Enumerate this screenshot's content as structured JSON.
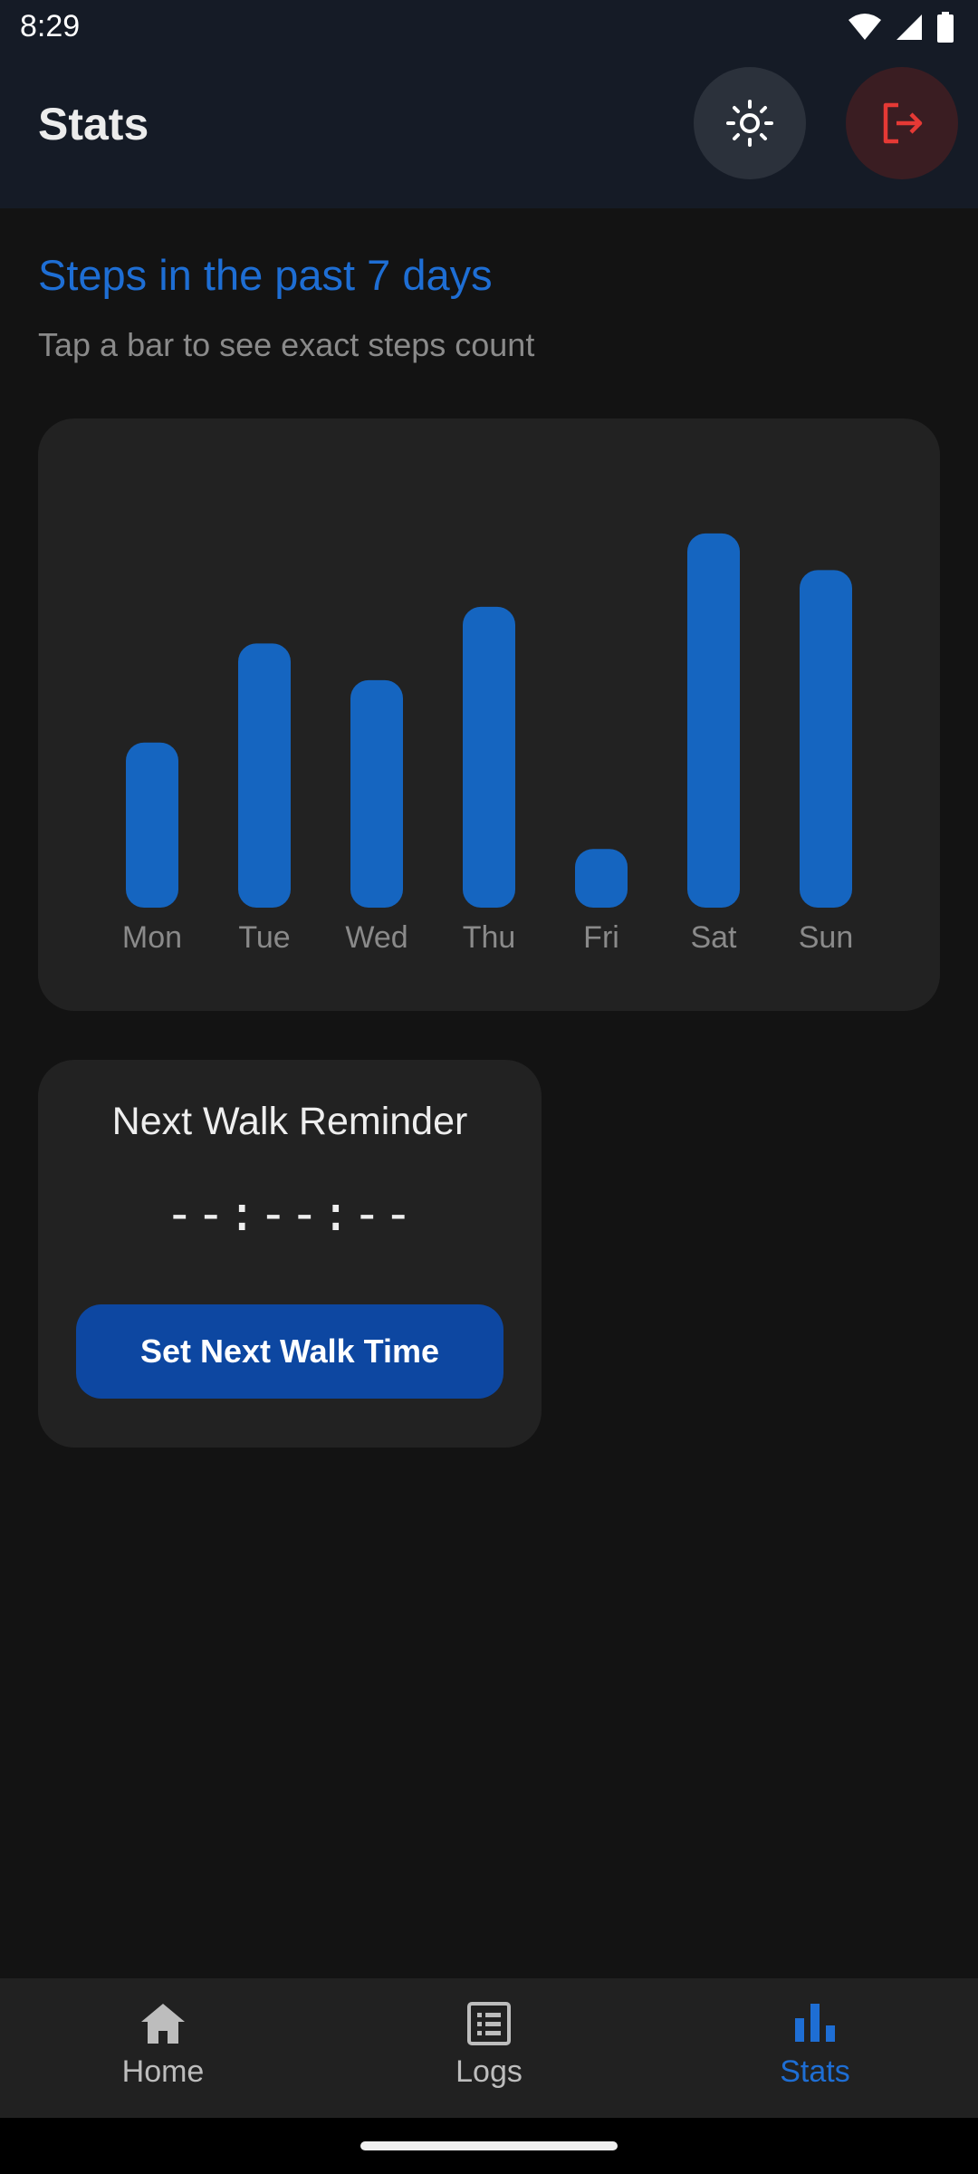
{
  "status_bar": {
    "time": "8:29"
  },
  "header": {
    "title": "Stats",
    "theme_icon": "sun-icon",
    "logout_icon": "logout-icon"
  },
  "stats": {
    "title": "Steps in the past 7 days",
    "subtitle": "Tap a bar to see exact steps count"
  },
  "chart_data": {
    "type": "bar",
    "categories": [
      "Mon",
      "Tue",
      "Wed",
      "Thu",
      "Fri",
      "Sat",
      "Sun"
    ],
    "values": [
      45,
      72,
      62,
      82,
      16,
      102,
      92
    ],
    "bar_color": "#1565c0",
    "label_color": "#8a8a8a",
    "grid": false
  },
  "reminder": {
    "title": "Next Walk Reminder",
    "time": "--:--:--",
    "button_label": "Set Next Walk Time"
  },
  "nav": {
    "items": [
      {
        "label": "Home",
        "icon": "home-icon",
        "active": false
      },
      {
        "label": "Logs",
        "icon": "list-icon",
        "active": false
      },
      {
        "label": "Stats",
        "icon": "bar-chart-icon",
        "active": true
      }
    ]
  },
  "colors": {
    "accent": "#1e6ed4",
    "button": "#0d47a1",
    "logout": "#e53935",
    "background": "#131313",
    "card": "#222222"
  }
}
